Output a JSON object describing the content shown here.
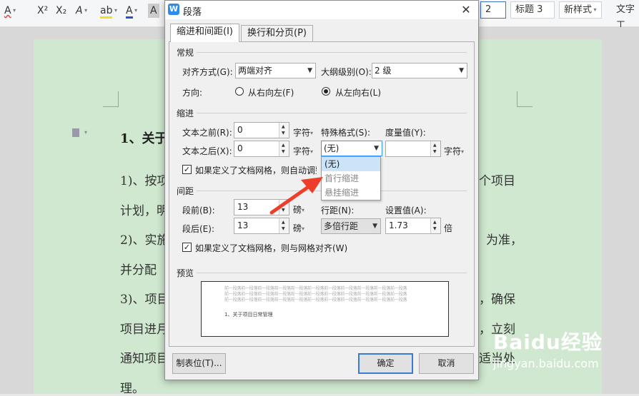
{
  "toolbar": {
    "font_btn": "A",
    "superscript": "X²",
    "subscript": "X₂",
    "outline": "A",
    "highlight": "ab",
    "font_color": "A",
    "char_shade": "A",
    "styles": [
      "2",
      "标题 3",
      "新样式"
    ],
    "text_tools": "文字工"
  },
  "document": {
    "lines": [
      "1、关于",
      "1)、按项",
      "计划，明",
      "2)、实施",
      "并分配",
      "3)、项目",
      "项目进月",
      "通知项目",
      "理。"
    ],
    "right_fragments": [
      "个项目",
      "为准，",
      "，确保",
      "，立刻",
      "适当处"
    ]
  },
  "dialog": {
    "title": "段落",
    "app_icon": "W",
    "close": "✕",
    "tabs": [
      "缩进和间距(I)",
      "换行和分页(P)"
    ],
    "general": {
      "section": "常规",
      "alignment_label": "对齐方式(G):",
      "alignment_value": "两端对齐",
      "outline_label": "大纲级别(O):",
      "outline_value": "2 级",
      "direction_label": "方向:",
      "rtl_label": "从右向左(F)",
      "ltr_label": "从左向右(L)",
      "selected_direction": "ltr"
    },
    "indent": {
      "section": "缩进",
      "before_label": "文本之前(R):",
      "before_value": "0",
      "before_unit": "字符",
      "after_label": "文本之后(X):",
      "after_value": "0",
      "after_unit": "字符",
      "special_label": "特殊格式(S):",
      "special_value": "(无)",
      "measure_label": "度量值(Y):",
      "measure_value": "",
      "measure_unit": "字符",
      "auto_adjust_label": "如果定义了文档网格，则自动调整",
      "auto_adjust_checked": true
    },
    "special_dropdown": [
      "(无)",
      "首行缩进",
      "悬挂缩进"
    ],
    "spacing": {
      "section": "间距",
      "before_label": "段前(B):",
      "before_value": "13",
      "before_unit": "磅",
      "after_label": "段后(E):",
      "after_value": "13",
      "after_unit": "磅",
      "line_label": "行距(N):",
      "line_value": "多倍行距",
      "setting_label": "设置值(A):",
      "setting_value": "1.73",
      "setting_unit": "倍",
      "grid_label": "如果定义了文档网格，则与网格对齐(W)",
      "grid_checked": true
    },
    "preview": {
      "section": "预览",
      "filler": "前一段落前一段落前一段落前一段落前一段落前一段落前一段落前一段落前一段落前一段落前一段落",
      "sample": "1、关于项目日常管理"
    },
    "buttons": {
      "tabs": "制表位(T)...",
      "ok": "确定",
      "cancel": "取消"
    }
  },
  "watermark": {
    "logo": "Baidu经验",
    "url": "jingyan.baidu.com"
  },
  "colors": {
    "page": "#cfe8cf",
    "accent": "#3a7ad1",
    "arrow": "#ee3e2a"
  }
}
